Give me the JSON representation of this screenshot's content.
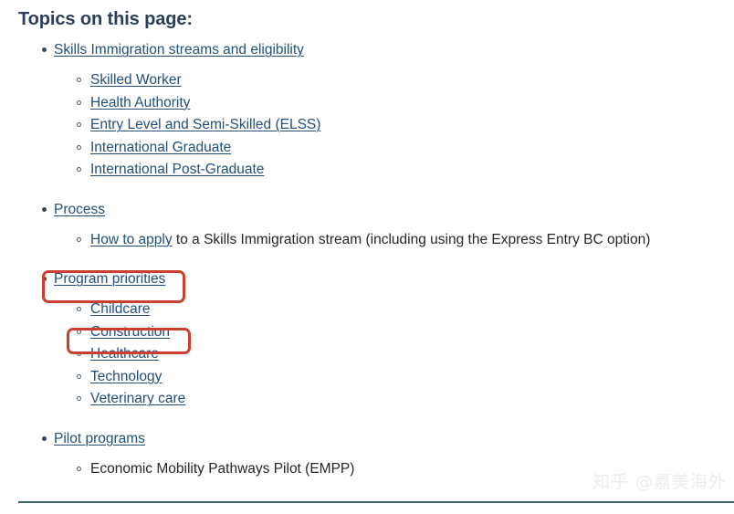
{
  "heading": "Topics on this page:",
  "colors": {
    "heading": "#2b3f5c",
    "link": "#234f79",
    "plain_text": "#262626",
    "annotation_red": "#c9402f",
    "rule_teal": "#3d6563",
    "watermark": "#e9ecef",
    "background": "#ffffff"
  },
  "outline": [
    {
      "label": "Skills Immigration streams and eligibility",
      "is_link": true,
      "children": [
        {
          "label": "Skilled Worker",
          "is_link": true
        },
        {
          "label": "Health Authority",
          "is_link": true
        },
        {
          "label": "Entry Level and Semi-Skilled (ELSS)",
          "is_link": true
        },
        {
          "label": "International Graduate",
          "is_link": true
        },
        {
          "label": "International Post-Graduate",
          "is_link": true
        }
      ]
    },
    {
      "label": "Process",
      "is_link": true,
      "children": [
        {
          "label": "How to apply",
          "is_link": true,
          "trailing_text": " to a Skills Immigration stream (including using the Express Entry BC option)"
        }
      ]
    },
    {
      "label": "Program priorities",
      "is_link": true,
      "highlighted": true,
      "children": [
        {
          "label": "Childcare",
          "is_link": true
        },
        {
          "label": "Construction",
          "is_link": true,
          "highlighted": true
        },
        {
          "label": "Healthcare",
          "is_link": true
        },
        {
          "label": "Technology",
          "is_link": true
        },
        {
          "label": "Veterinary care",
          "is_link": true
        }
      ]
    },
    {
      "label": "Pilot programs",
      "is_link": true,
      "children": [
        {
          "label": "Economic Mobility Pathways Pilot (EMPP)",
          "is_link": false
        }
      ]
    }
  ],
  "annotations": [
    {
      "name": "program-priorities",
      "target": "Program priorities",
      "shape": "rounded-rectangle",
      "color": "#c9402f"
    },
    {
      "name": "construction",
      "target": "Construction",
      "shape": "rounded-rectangle",
      "color": "#c9402f"
    }
  ],
  "watermark": "知乎 @嘉美海外"
}
